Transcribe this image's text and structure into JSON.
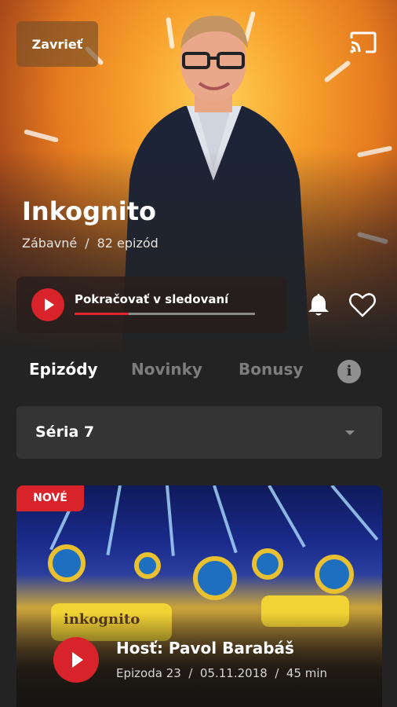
{
  "header": {
    "close_label": "Zavrieť",
    "cast_icon": "cast-icon"
  },
  "show": {
    "title": "Inkognito",
    "genre": "Zábavné",
    "separator": "/",
    "episode_count": "82 epizód"
  },
  "continue_watching": {
    "label": "Pokračovať v sledovaní",
    "progress": 0.3
  },
  "tabs": [
    {
      "label": "Epizódy",
      "active": true
    },
    {
      "label": "Novinky",
      "active": false
    },
    {
      "label": "Bonusy",
      "active": false
    }
  ],
  "season_select": {
    "selected": "Séria 7"
  },
  "episode": {
    "badge": "NOVÉ",
    "title": "Hosť: Pavol Barabáš",
    "meta": "Epizoda 23  /  05.11.2018  /  45 min",
    "desk_logo": "inkognito"
  },
  "colors": {
    "accent": "#d8232a",
    "background": "#232323"
  }
}
